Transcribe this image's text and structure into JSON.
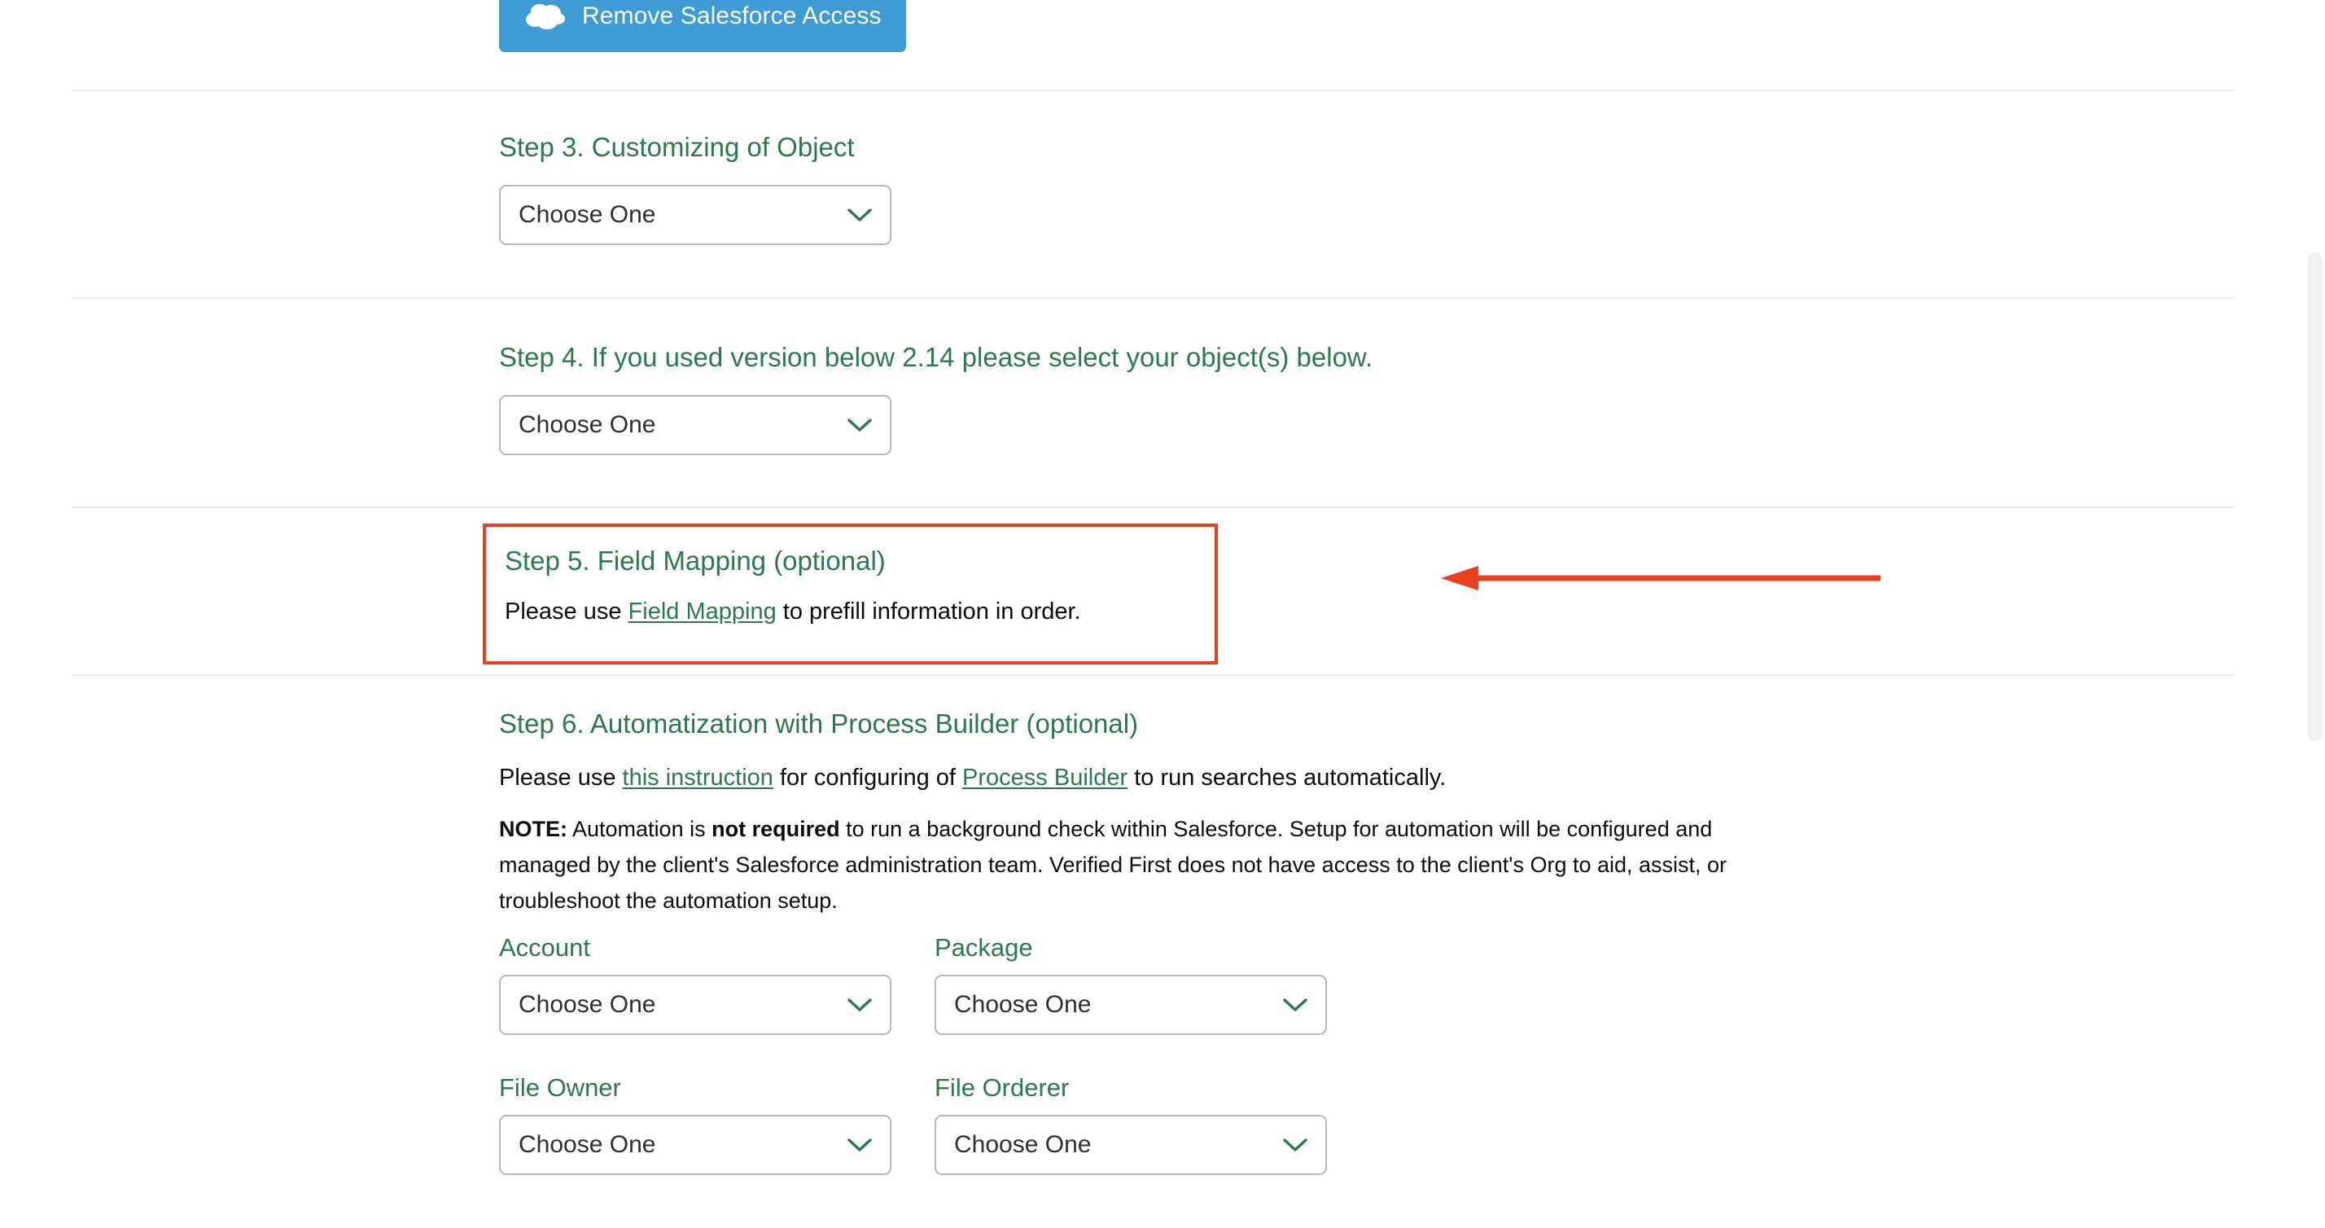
{
  "top_button": {
    "label": "Remove Salesforce Access",
    "icon": "salesforce-cloud-icon",
    "bg_color": "#3e9bd4",
    "text_color": "#ffffff"
  },
  "colors": {
    "green": "#2b7a4b",
    "annotation_red": "#e8401f",
    "divider": "#e9e9e9",
    "select_border": "#b8b8b8"
  },
  "select_placeholder": "Choose One",
  "steps": [
    {
      "id": "step3",
      "heading": "Step 3. Customizing of Object",
      "select_value": "Choose One"
    },
    {
      "id": "step4",
      "heading": "Step 4. If you used version below 2.14 please select your object(s) below.",
      "select_value": "Choose One"
    },
    {
      "id": "step5",
      "heading": "Step 5. Field Mapping (optional)",
      "text_before": "Please use ",
      "link_label": "Field Mapping",
      "text_after": " to prefill information in order.",
      "highlighted": true
    },
    {
      "id": "step6",
      "heading": "Step 6. Automatization with Process Builder (optional)",
      "text_part1": "Please use ",
      "link1_label": "this instruction",
      "text_part2": " for configuring of ",
      "link2_label": "Process Builder",
      "text_part3": " to run searches automatically.",
      "note_prefix": "NOTE:",
      "note_part1": " Automation is ",
      "note_bold": "not required",
      "note_part2": " to run a background check within Salesforce. Setup for automation will be configured and managed by the client's Salesforce administration team. Verified First does not have access to the client's Org to aid, assist, or troubleshoot the automation setup."
    }
  ],
  "automation_fields": [
    {
      "label": "Account",
      "value": "Choose One"
    },
    {
      "label": "Package",
      "value": "Choose One"
    },
    {
      "label": "File Owner",
      "value": "Choose One"
    },
    {
      "label": "File Orderer",
      "value": "Choose One"
    }
  ],
  "annotation": {
    "arrow_direction": "left",
    "color": "#e8401f"
  }
}
